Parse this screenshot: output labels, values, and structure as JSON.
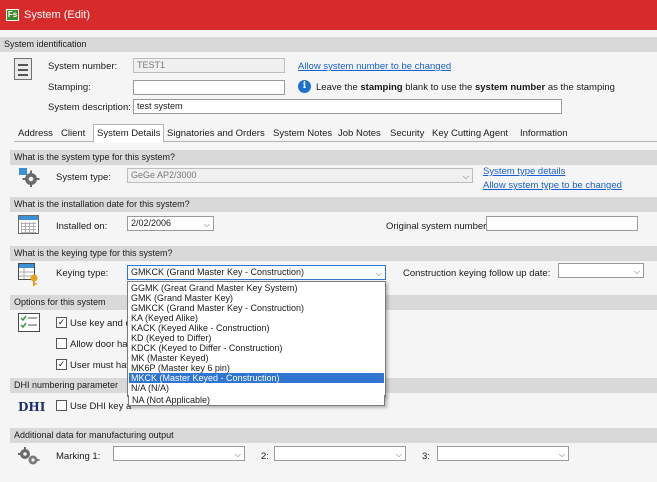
{
  "window": {
    "title": "System (Edit)",
    "app_icon": "Fs"
  },
  "identification": {
    "header": "System identification",
    "number_label": "System number:",
    "number_value": "TEST1",
    "allow_change_link": "Allow system number to be changed",
    "stamping_label": "Stamping:",
    "stamping_value": "",
    "hint_pre": "Leave the ",
    "hint_b1": "stamping",
    "hint_mid": " blank to use the ",
    "hint_b2": "system number",
    "hint_post": " as the stamping",
    "description_label": "System description:",
    "description_value": "test system"
  },
  "tabs": [
    "Address",
    "Client",
    "System Details",
    "Signatories and Orders",
    "System Notes",
    "Job Notes",
    "Security",
    "Key Cutting Agent",
    "Information"
  ],
  "active_tab": "System Details",
  "system_type": {
    "header": "What is the system type for this system?",
    "label": "System type:",
    "value": "GeGe AP2/3000",
    "details_link": "System type details",
    "allow_change_link": "Allow system type to be changed"
  },
  "installation": {
    "header": "What is the installation date for this system?",
    "label": "Installed on:",
    "value": "2/02/2006",
    "original_label": "Original system number:",
    "original_value": ""
  },
  "keying": {
    "header": "What is the keying type for this system?",
    "label": "Keying type:",
    "value": "GMKCK (Grand Master Key - Construction)",
    "followup_label": "Construction keying follow up date:",
    "followup_value": "",
    "options": [
      "GGMK (Great Grand Master Key System)",
      "GMK (Grand Master Key)",
      "GMKCK (Grand Master Key - Construction)",
      "KA (Keyed Alike)",
      "KACK (Keyed Alike - Construction)",
      "KD (Keyed to Differ)",
      "KDCK (Keyed to Differ - Construction)",
      "MK (Master Keyed)",
      "MK6P (Master key 6 pin)",
      "MKCK (Master Keyed - Construction)",
      "N/A (N/A)",
      "NA (Not Applicable)"
    ],
    "highlighted_option": "MKCK (Master Keyed - Construction)"
  },
  "options": {
    "header": "Options for this system",
    "opt1": "Use key and d",
    "opt1_checked": true,
    "opt2": "Allow door har",
    "opt2_checked": false,
    "opt3": "User must hav",
    "opt3_checked": true
  },
  "dhi": {
    "header": "DHI numbering parameter",
    "logo": "DHI",
    "checkbox": "Use DHI key a",
    "checked": false
  },
  "manufacturing": {
    "header": "Additional data for manufacturing output",
    "marking1_label": "Marking 1:",
    "label2": "2:",
    "label3": "3:",
    "marking1_value": "",
    "marking2_value": "",
    "marking3_value": ""
  },
  "colors": {
    "titlebar": "#d72a2a",
    "link": "#1a5fd1",
    "selection": "#2f75d1"
  }
}
